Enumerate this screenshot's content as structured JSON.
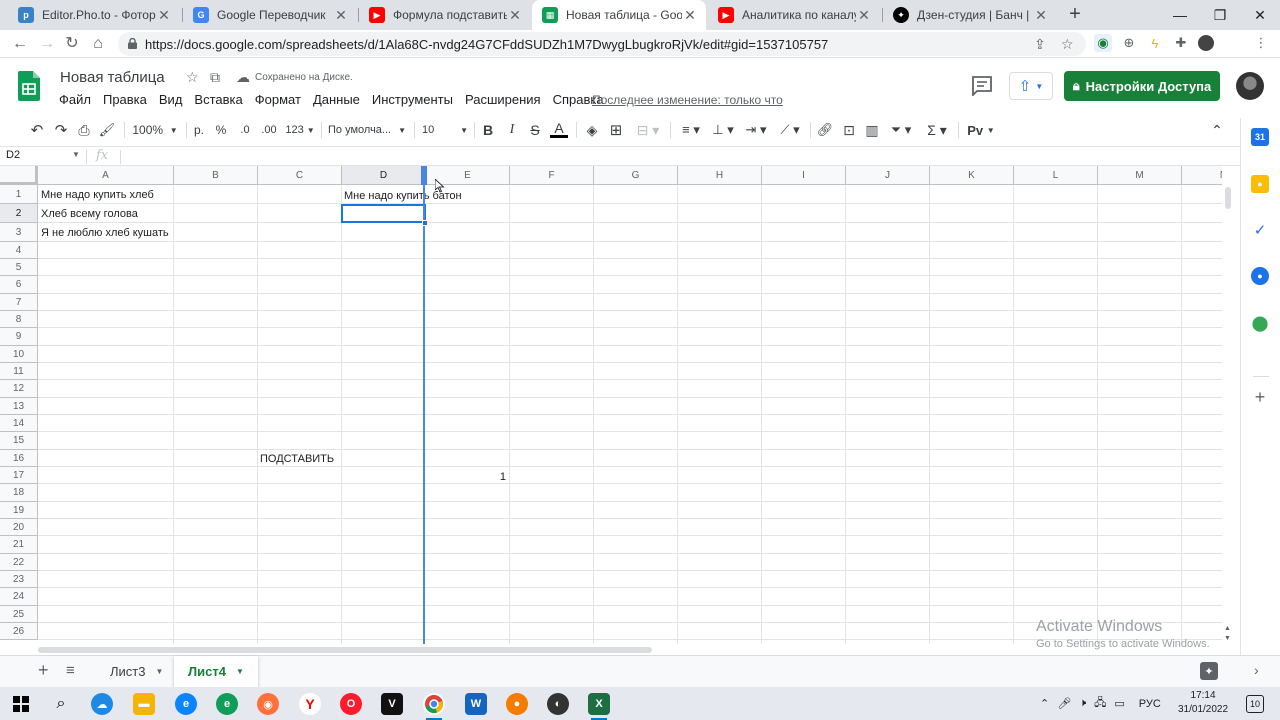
{
  "browser": {
    "tabs": [
      {
        "title": "Editor.Pho.to - Фоторедактор",
        "icon": "pho-favicon",
        "color": "#3b82c4"
      },
      {
        "title": "Google Переводчик",
        "icon": "translate-favicon",
        "color": "#4285f4"
      },
      {
        "title": "Формула подставить (substitute)",
        "icon": "youtube-favicon",
        "color": "#ff0000"
      },
      {
        "title": "Новая таблица - Google Таблицы",
        "icon": "sheets-favicon",
        "color": "#0f9d58"
      },
      {
        "title": "Аналитика по каналу - YouTube",
        "icon": "youtube-favicon",
        "color": "#ff0000"
      },
      {
        "title": "Дзен-студия | Банч | Яндекс",
        "icon": "zen-favicon",
        "color": "#000000"
      }
    ],
    "url": "https://docs.google.com/spreadsheets/d/1Ala68C-nvdg24G7CFddSUDZh1M7DwygLbugkroRjVk/edit#gid=1537105757"
  },
  "doc": {
    "title": "Новая таблица",
    "saved_status": "Сохранено на Диске.",
    "menu": [
      "Файл",
      "Правка",
      "Вид",
      "Вставка",
      "Формат",
      "Данные",
      "Инструменты",
      "Расширения",
      "Справка"
    ],
    "last_edit": "Последнее изменение: только что",
    "share_label": "Настройки Доступа"
  },
  "toolbar": {
    "zoom": "100%",
    "currency": "р.",
    "percent": "%",
    "dec_less": ".0",
    "dec_more": ".00",
    "format_more": "123",
    "font": "По умолча...",
    "font_size": "10",
    "bold": "B",
    "italic": "I",
    "strike": "S",
    "text_color": "A",
    "input_tools": "Рv"
  },
  "formula_bar": {
    "name_box": "D2",
    "fx": "fx",
    "content": ""
  },
  "grid": {
    "columns": [
      "A",
      "B",
      "C",
      "D",
      "E",
      "F",
      "G",
      "H",
      "I",
      "J",
      "K",
      "L",
      "M",
      "N"
    ],
    "selected_column": "D",
    "selected_row": "2",
    "rows": [
      "1",
      "2",
      "3",
      "4",
      "5",
      "6",
      "7",
      "8",
      "9",
      "10",
      "11",
      "12",
      "13",
      "14",
      "15",
      "16",
      "17",
      "18",
      "19",
      "20",
      "21",
      "22",
      "23",
      "24",
      "25",
      "26"
    ],
    "cells": {
      "A1": "Мне надо купить хлеб",
      "A2": "Хлеб всему голова",
      "A3": "Я не люблю хлеб кушать",
      "D1": "Мне надо купить батон",
      "C16": "ПОДСТАВИТЬ",
      "E17": "1"
    }
  },
  "sheets": {
    "tabs": [
      {
        "label": "Лист3",
        "active": false
      },
      {
        "label": "Лист4",
        "active": true
      }
    ]
  },
  "watermark": {
    "title": "Activate Windows",
    "subtitle": "Go to Settings to activate Windows."
  },
  "taskbar": {
    "language": "РУС",
    "time": "17:14",
    "date": "31/01/2022",
    "notifications": "10"
  },
  "colors": {
    "accent": "#1a73e8",
    "share_green": "#188038",
    "sheets_green": "#0f9d58"
  }
}
